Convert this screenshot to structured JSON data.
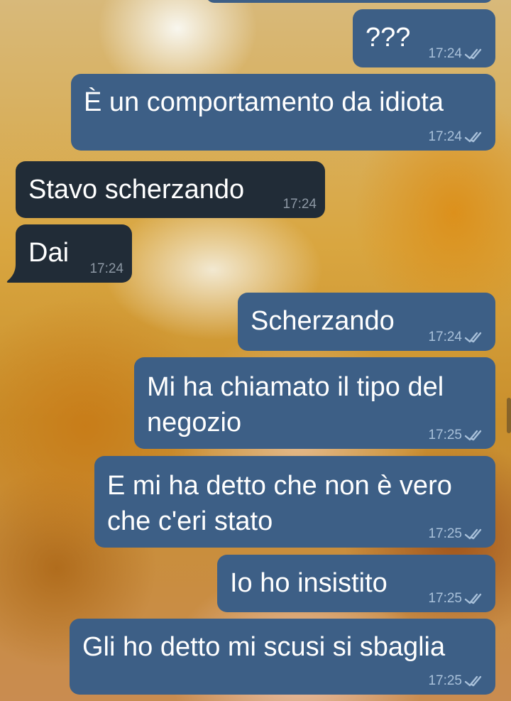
{
  "messages": [
    {
      "text": "???",
      "time": "17:24",
      "direction": "outgoing",
      "status": "read"
    },
    {
      "text": "È un comportamento da idiota",
      "time": "17:24",
      "direction": "outgoing",
      "status": "read"
    },
    {
      "text": "Stavo scherzando",
      "time": "17:24",
      "direction": "incoming"
    },
    {
      "text": "Dai",
      "time": "17:24",
      "direction": "incoming"
    },
    {
      "text": "Scherzando",
      "time": "17:24",
      "direction": "outgoing",
      "status": "read"
    },
    {
      "line1": "Mi ha chiamato il tipo del",
      "line2": "negozio",
      "time": "17:25",
      "direction": "outgoing",
      "status": "read"
    },
    {
      "line1": "E mi ha detto che non è vero",
      "line2": "che c'eri stato",
      "time": "17:25",
      "direction": "outgoing",
      "status": "read"
    },
    {
      "text": "Io ho insistito",
      "time": "17:25",
      "direction": "outgoing",
      "status": "read"
    },
    {
      "text": "Gli ho detto mi scusi si sbaglia",
      "time": "17:25",
      "direction": "outgoing",
      "status": "read"
    }
  ],
  "colors": {
    "outgoing_bubble": "#3d5f86",
    "incoming_bubble": "#212c37",
    "read_ticks": "#a9c1da"
  }
}
